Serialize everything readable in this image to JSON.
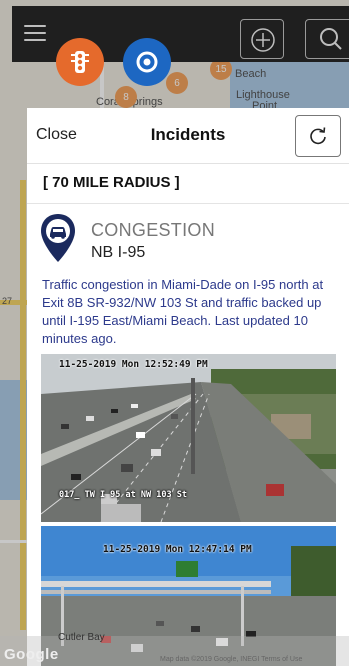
{
  "map": {
    "labels": {
      "beach": "Beach",
      "lighthouse": "Lighthouse",
      "point": "Point",
      "coral_springs": "Coral Springs",
      "bay": "Cutler Bay",
      "bay_number": "27"
    },
    "badges": [
      "6",
      "8",
      "15",
      "6"
    ],
    "google": "Google",
    "attribution": "Map data ©2019 Google, INEGI   Terms of Use"
  },
  "topbar": {
    "menu_icon": "hamburger-icon",
    "add_icon": "plus-circle-icon",
    "search_icon": "search-icon"
  },
  "layers": {
    "traffic_icon": "traffic-light-icon",
    "camera_icon": "target-icon",
    "colors": {
      "traffic": "#e56a2c",
      "camera": "#1d67c2"
    }
  },
  "modal": {
    "close_label": "Close",
    "title": "Incidents",
    "refresh_icon": "refresh-icon",
    "radius_label": "[ 70 MILE RADIUS ]",
    "incident": {
      "icon": "car-pin-icon",
      "type": "CONGESTION",
      "road": "NB I-95",
      "description": "Traffic congestion in Miami-Dade on I-95 north at Exit 8B SR-932/NW 103 St and traffic backed up until I-195 East/Miami Beach. Last updated 10 minutes ago.",
      "colors": {
        "pin": "#1b2a5e",
        "description": "#2d3a8c"
      }
    },
    "cameras": [
      {
        "timestamp": "11-25-2019 Mon 12:52:49 PM",
        "caption": "017_  TW  I 95 at NW 103 St"
      },
      {
        "timestamp": "11-25-2019 Mon 12:47:14 PM",
        "caption": ""
      }
    ]
  }
}
